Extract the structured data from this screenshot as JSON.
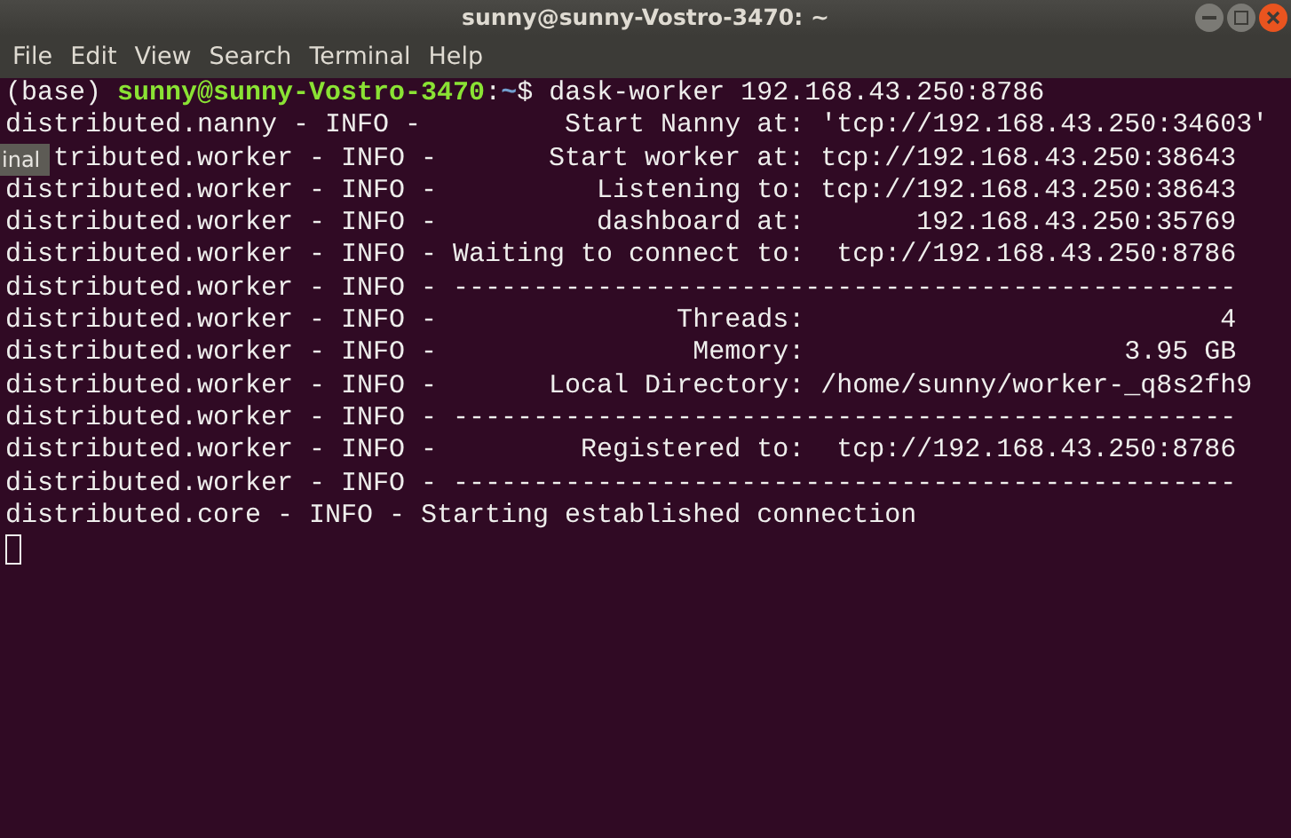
{
  "window": {
    "title": "sunny@sunny-Vostro-3470: ~"
  },
  "menu": [
    "File",
    "Edit",
    "View",
    "Search",
    "Terminal",
    "Help"
  ],
  "tooltip": {
    "text": "inal"
  },
  "lines": [
    {
      "kind": "prompt",
      "env": "(base)",
      "user_host": "sunny@sunny-Vostro-3470",
      "separator": ":",
      "path": "~",
      "symbol": "$",
      "command": "dask-worker 192.168.43.250:8786"
    },
    {
      "kind": "log",
      "text": "distributed.nanny - INFO -         Start Nanny at: 'tcp://192.168.43.250:34603'"
    },
    {
      "kind": "covered_log",
      "text": "tributed.worker - INFO -       Start worker at: tcp://192.168.43.250:38643"
    },
    {
      "kind": "log",
      "text": "distributed.worker - INFO -          Listening to: tcp://192.168.43.250:38643"
    },
    {
      "kind": "log",
      "text": "distributed.worker - INFO -          dashboard at:       192.168.43.250:35769"
    },
    {
      "kind": "log",
      "text": "distributed.worker - INFO - Waiting to connect to:  tcp://192.168.43.250:8786"
    },
    {
      "kind": "log",
      "text": "distributed.worker - INFO - -------------------------------------------------"
    },
    {
      "kind": "log",
      "text": "distributed.worker - INFO -               Threads:                          4"
    },
    {
      "kind": "log",
      "text": "distributed.worker - INFO -                Memory:                    3.95 GB"
    },
    {
      "kind": "log",
      "text": "distributed.worker - INFO -       Local Directory: /home/sunny/worker-_q8s2fh9"
    },
    {
      "kind": "log",
      "text": "distributed.worker - INFO - -------------------------------------------------"
    },
    {
      "kind": "log",
      "text": "distributed.worker - INFO -         Registered to:  tcp://192.168.43.250:8786"
    },
    {
      "kind": "log",
      "text": "distributed.worker - INFO - -------------------------------------------------"
    },
    {
      "kind": "log",
      "text": "distributed.core - INFO - Starting established connection"
    },
    {
      "kind": "cursor"
    }
  ]
}
